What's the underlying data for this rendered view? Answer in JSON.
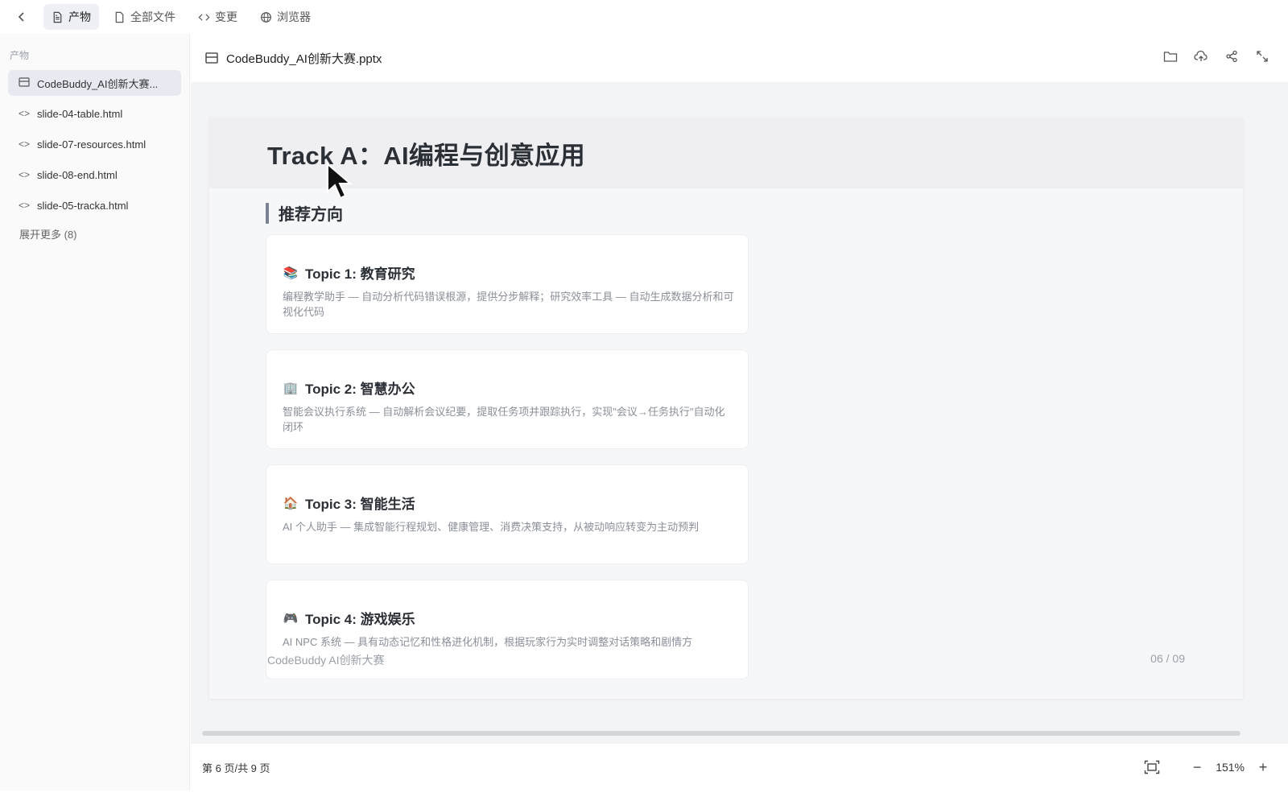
{
  "topbar": {
    "tabs": [
      {
        "label": "产物",
        "icon": "document-icon",
        "active": true
      },
      {
        "label": "全部文件",
        "icon": "file-icon",
        "active": false
      },
      {
        "label": "变更",
        "icon": "code-icon",
        "active": false
      },
      {
        "label": "浏览器",
        "icon": "globe-icon",
        "active": false
      }
    ]
  },
  "sidebar": {
    "header": "产物",
    "files": [
      {
        "label": "CodeBuddy_AI创新大赛...",
        "icon": "slides-icon",
        "active": true
      },
      {
        "label": "slide-04-table.html",
        "icon": "code-icon",
        "active": false
      },
      {
        "label": "slide-07-resources.html",
        "icon": "code-icon",
        "active": false
      },
      {
        "label": "slide-08-end.html",
        "icon": "code-icon",
        "active": false
      },
      {
        "label": "slide-05-tracka.html",
        "icon": "code-icon",
        "active": false
      }
    ],
    "expand_more": "展开更多 (8)"
  },
  "main": {
    "doc_title": "CodeBuddy_AI创新大赛.pptx",
    "actions": [
      "folder-icon",
      "upload-cloud-icon",
      "share-icon",
      "expand-icon"
    ]
  },
  "slide": {
    "title": "Track A：AI编程与创意应用",
    "section": "推荐方向",
    "topics": [
      {
        "emoji": "📚",
        "title": "Topic 1: 教育研究",
        "desc": "编程教学助手 — 自动分析代码错误根源，提供分步解释；研究效率工具 — 自动生成数据分析和可视化代码"
      },
      {
        "emoji": "🏢",
        "title": "Topic 2: 智慧办公",
        "desc": "智能会议执行系统 — 自动解析会议纪要，提取任务项并跟踪执行，实现\"会议→任务执行\"自动化闭环"
      },
      {
        "emoji": "🏠",
        "title": "Topic 3: 智能生活",
        "desc": "AI 个人助手 — 集成智能行程规划、健康管理、消费决策支持，从被动响应转变为主动预判"
      },
      {
        "emoji": "🎮",
        "title": "Topic 4: 游戏娱乐",
        "desc": "AI NPC 系统 — 具有动态记忆和性格进化机制，根据玩家行为实时调整对话策略和剧情方"
      }
    ],
    "footer_left": "CodeBuddy AI创新大赛",
    "footer_right": "06 / 09"
  },
  "bottombar": {
    "page_indicator": "第 6 页/共 9 页",
    "zoom": "151%",
    "zoom_out": "−",
    "zoom_in": "+"
  }
}
